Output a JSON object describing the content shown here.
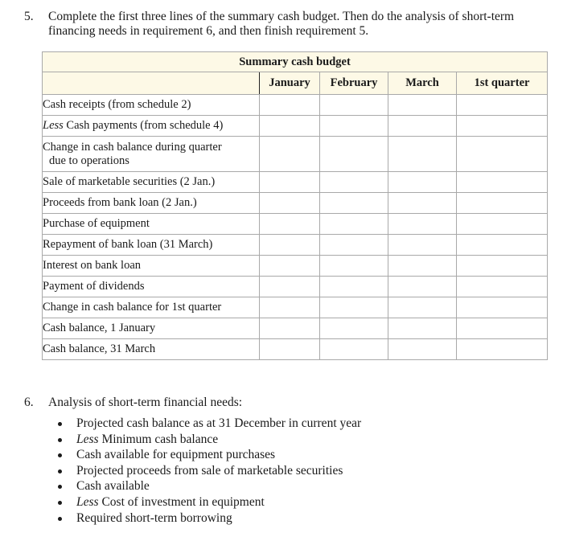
{
  "requirement5": {
    "number": "5.",
    "line1": "Complete the first three lines of the summary cash budget. Then do the analysis of short-term",
    "line2": "financing needs in requirement 6, and then finish requirement 5."
  },
  "table": {
    "title": "Summary cash budget",
    "columns": [
      "January",
      "February",
      "March",
      "1st quarter"
    ],
    "rows": [
      {
        "prefix": "",
        "label": "Cash receipts (from schedule 2)",
        "label2": "",
        "values": [
          "",
          "",
          "",
          ""
        ]
      },
      {
        "prefix": "Less",
        "label": " Cash payments (from schedule 4)",
        "label2": "",
        "values": [
          "",
          "",
          "",
          ""
        ]
      },
      {
        "prefix": "",
        "label": "Change in cash balance during quarter",
        "label2": "due to operations",
        "values": [
          "",
          "",
          "",
          ""
        ]
      },
      {
        "prefix": "",
        "label": "Sale of marketable securities (2 Jan.)",
        "label2": "",
        "values": [
          "",
          "",
          "",
          ""
        ]
      },
      {
        "prefix": "",
        "label": "Proceeds from bank loan (2 Jan.)",
        "label2": "",
        "values": [
          "",
          "",
          "",
          ""
        ]
      },
      {
        "prefix": "",
        "label": "Purchase of equipment",
        "label2": "",
        "values": [
          "",
          "",
          "",
          ""
        ]
      },
      {
        "prefix": "",
        "label": "Repayment of bank loan (31 March)",
        "label2": "",
        "values": [
          "",
          "",
          "",
          ""
        ]
      },
      {
        "prefix": "",
        "label": "Interest on bank loan",
        "label2": "",
        "values": [
          "",
          "",
          "",
          ""
        ]
      },
      {
        "prefix": "",
        "label": "Payment of dividends",
        "label2": "",
        "values": [
          "",
          "",
          "",
          ""
        ]
      },
      {
        "prefix": "",
        "label": "Change in cash balance for 1st quarter",
        "label2": "",
        "values": [
          "",
          "",
          "",
          ""
        ]
      },
      {
        "prefix": "",
        "label": "Cash balance, 1 January",
        "label2": "",
        "values": [
          "",
          "",
          "",
          ""
        ]
      },
      {
        "prefix": "",
        "label": "Cash balance, 31 March",
        "label2": "",
        "values": [
          "",
          "",
          "",
          ""
        ]
      }
    ]
  },
  "requirement6": {
    "number": "6.",
    "title": "Analysis of short-term financial needs:",
    "bullets": [
      {
        "prefix": "",
        "text": "Projected cash balance as at 31 December in current year"
      },
      {
        "prefix": "Less",
        "text": " Minimum cash balance"
      },
      {
        "prefix": "",
        "text": "Cash available for equipment purchases"
      },
      {
        "prefix": "",
        "text": "Projected proceeds from sale of marketable securities"
      },
      {
        "prefix": "",
        "text": "Cash available"
      },
      {
        "prefix": "Less",
        "text": " Cost of investment in equipment"
      },
      {
        "prefix": "",
        "text": "Required short-term borrowing"
      }
    ]
  }
}
